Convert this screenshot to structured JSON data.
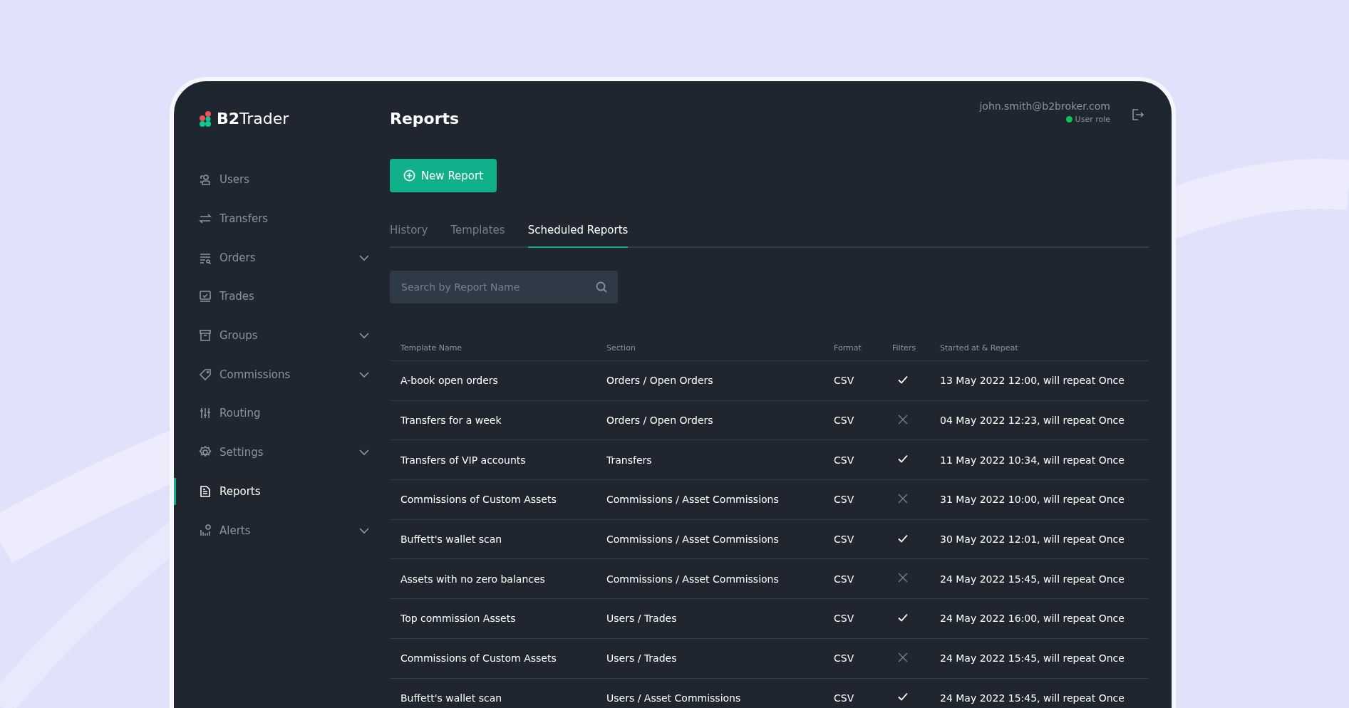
{
  "brand": {
    "name_bold": "B2",
    "name": "Trader"
  },
  "sidebar": {
    "items": [
      {
        "label": "Users",
        "expandable": false,
        "selected": false
      },
      {
        "label": "Transfers",
        "expandable": false,
        "selected": false
      },
      {
        "label": "Orders",
        "expandable": true,
        "selected": false
      },
      {
        "label": "Trades",
        "expandable": false,
        "selected": false
      },
      {
        "label": "Groups",
        "expandable": true,
        "selected": false
      },
      {
        "label": "Commissions",
        "expandable": true,
        "selected": false
      },
      {
        "label": "Routing",
        "expandable": false,
        "selected": false
      },
      {
        "label": "Settings",
        "expandable": true,
        "selected": false
      },
      {
        "label": "Reports",
        "expandable": false,
        "selected": true
      },
      {
        "label": "Alerts",
        "expandable": true,
        "selected": false
      }
    ]
  },
  "page_title": "Reports",
  "user": {
    "email": "john.smith@b2broker.com",
    "role": "User role",
    "online": true
  },
  "new_button": "New Report",
  "tabs": [
    {
      "label": "History",
      "selected": false
    },
    {
      "label": "Templates",
      "selected": false
    },
    {
      "label": "Scheduled Reports",
      "selected": true
    }
  ],
  "search": {
    "placeholder": "Search by Report Name"
  },
  "table": {
    "columns": [
      "Template Name",
      "Section",
      "Format",
      "Filters",
      "Started at & Repeat"
    ],
    "rows": [
      {
        "name": "A-book open orders",
        "section": "Orders / Open Orders",
        "format": "CSV",
        "filters": true,
        "started": "13 May 2022 12:00, will repeat Once"
      },
      {
        "name": "Transfers for a week",
        "section": "Orders / Open Orders",
        "format": "CSV",
        "filters": false,
        "started": "04 May 2022 12:23, will repeat Once"
      },
      {
        "name": "Transfers of VIP accounts",
        "section": "Transfers",
        "format": "CSV",
        "filters": true,
        "started": "11 May 2022 10:34, will repeat Once"
      },
      {
        "name": "Commissions of Custom Assets",
        "section": "Commissions / Asset Commissions",
        "format": "CSV",
        "filters": false,
        "started": "31 May 2022 10:00, will repeat Once"
      },
      {
        "name": "Buffett's wallet scan",
        "section": "Commissions / Asset Commissions",
        "format": "CSV",
        "filters": true,
        "started": "30 May 2022 12:01, will repeat Once"
      },
      {
        "name": "Assets with no zero balances",
        "section": "Commissions / Asset Commissions",
        "format": "CSV",
        "filters": false,
        "started": "24 May 2022 15:45, will repeat Once"
      },
      {
        "name": "Top commission Assets",
        "section": "Users / Trades",
        "format": "CSV",
        "filters": true,
        "started": "24 May 2022 16:00, will repeat Once"
      },
      {
        "name": "Commissions of Custom Assets",
        "section": "Users / Trades",
        "format": "CSV",
        "filters": false,
        "started": "24 May 2022 15:45, will repeat Once"
      },
      {
        "name": "Buffett's wallet scan",
        "section": "Users / Asset Commissions",
        "format": "CSV",
        "filters": true,
        "started": "24 May 2022 15:45, will repeat Once"
      }
    ]
  }
}
